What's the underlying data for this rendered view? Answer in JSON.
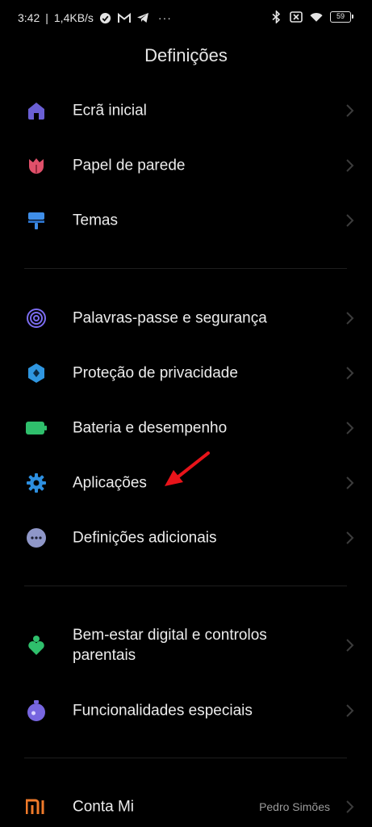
{
  "status_bar": {
    "time": "3:42",
    "separator": "|",
    "net_speed": "1,4KB/s",
    "more": "···",
    "battery": "59"
  },
  "header": {
    "title": "Definições"
  },
  "groups": [
    {
      "items": [
        {
          "label": "Ecrã inicial",
          "icon": "home-icon"
        },
        {
          "label": "Papel de parede",
          "icon": "tulip-icon"
        },
        {
          "label": "Temas",
          "icon": "paint-roller-icon"
        }
      ]
    },
    {
      "items": [
        {
          "label": "Palavras-passe e segurança",
          "icon": "fingerprint-icon"
        },
        {
          "label": "Proteção de privacidade",
          "icon": "privacy-shield-icon"
        },
        {
          "label": "Bateria e desempenho",
          "icon": "battery-icon"
        },
        {
          "label": "Aplicações",
          "icon": "gear-icon"
        },
        {
          "label": "Definições adicionais",
          "icon": "more-dots-icon"
        }
      ]
    },
    {
      "items": [
        {
          "label_line1": "Bem-estar digital e controlos",
          "label_line2": "parentais",
          "icon": "wellbeing-icon"
        },
        {
          "label": "Funcionalidades especiais",
          "icon": "special-features-icon"
        }
      ]
    },
    {
      "items": [
        {
          "label": "Conta Mi",
          "value": "Pedro Simões",
          "icon": "mi-logo-icon"
        }
      ]
    }
  ],
  "colors": {
    "background": "#000000",
    "home": "#6a5fd4",
    "tulip": "#e0506a",
    "themes": "#3f8ee8",
    "fingerprint": "#7b6cf0",
    "privacy": "#2f96e0",
    "battery": "#2fbf6c",
    "gear": "#2d8fe0",
    "more": "#8f97c8",
    "wellbeing": "#2fbf6c",
    "special": "#7766e0",
    "mi": "#f07a2a",
    "annotation_arrow": "#e8141a"
  }
}
